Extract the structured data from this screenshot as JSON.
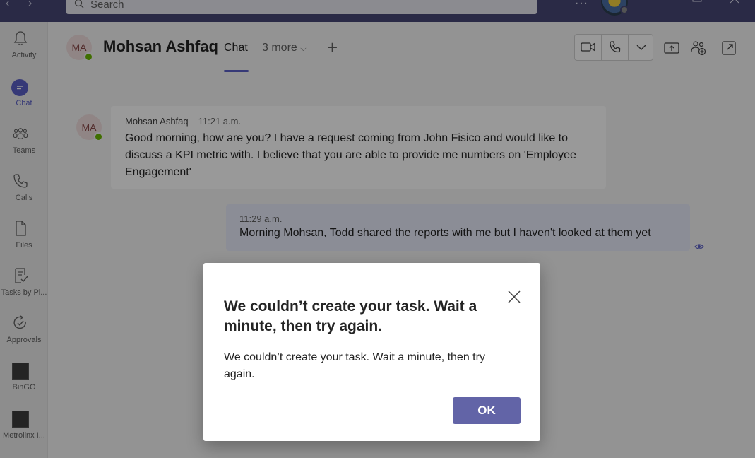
{
  "titlebar": {
    "search_placeholder": "Search",
    "more_label": "···"
  },
  "rail": {
    "items": [
      {
        "label": "Activity",
        "icon": "bell-icon"
      },
      {
        "label": "Chat",
        "icon": "chat-icon"
      },
      {
        "label": "Teams",
        "icon": "teams-icon"
      },
      {
        "label": "Calls",
        "icon": "phone-icon"
      },
      {
        "label": "Files",
        "icon": "file-icon"
      },
      {
        "label": "Tasks by Pl...",
        "icon": "tasks-icon"
      },
      {
        "label": "Approvals",
        "icon": "approvals-icon"
      },
      {
        "label": "BinGO",
        "icon": "app-tile-icon"
      },
      {
        "label": "Metrolinx I...",
        "icon": "app-tile-icon"
      }
    ]
  },
  "header": {
    "avatar_initials": "MA",
    "name": "Mohsan Ashfaq",
    "tab_chat": "Chat",
    "tab_more": "3 more",
    "add_tab": "+"
  },
  "messages": [
    {
      "avatar_initials": "MA",
      "sender": "Mohsan Ashfaq",
      "time": "11:21 a.m.",
      "text": "Good morning, how are you? I have a request coming from John Fisico and would like to discuss a KPI metric with. I believe that you are able to provide me numbers on 'Employee Engagement'"
    },
    {
      "time": "11:29 a.m.",
      "text": "Morning Mohsan, Todd shared the reports with me but I haven't looked at them yet"
    }
  ],
  "dialog": {
    "title": "We couldn’t create your task. Wait a minute, then try again.",
    "body": "We couldn’t create your task. Wait a minute, then try again.",
    "ok_label": "OK"
  },
  "colors": {
    "brand": "#6264a7",
    "titlebar": "#464775",
    "presence_available": "#6bb700"
  }
}
